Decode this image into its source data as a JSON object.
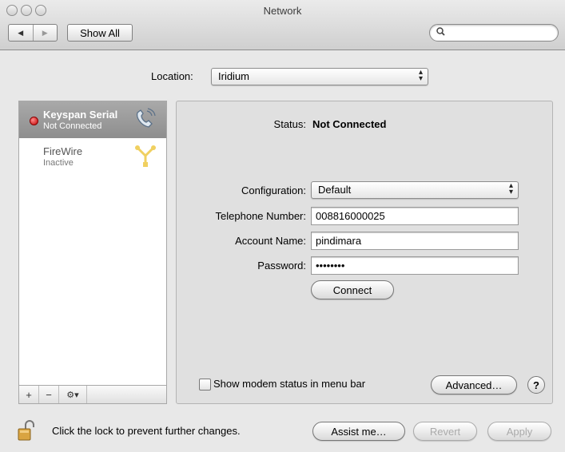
{
  "window": {
    "title": "Network"
  },
  "toolbar": {
    "show_all": "Show All",
    "search_placeholder": ""
  },
  "location": {
    "label": "Location:",
    "value": "Iridium"
  },
  "services": [
    {
      "name": "Keyspan Serial",
      "status": "Not Connected",
      "icon": "phone-modem-icon",
      "selected": true,
      "status_color": "#cc0000"
    },
    {
      "name": "FireWire",
      "status": "Inactive",
      "icon": "firewire-icon",
      "selected": false
    }
  ],
  "sidebar_controls": {
    "add": "+",
    "remove": "−",
    "action": "⚙▾"
  },
  "detail": {
    "status_label": "Status:",
    "status_value": "Not Connected",
    "configuration_label": "Configuration:",
    "configuration_value": "Default",
    "telephone_label": "Telephone Number:",
    "telephone_value": "008816000025",
    "account_label": "Account Name:",
    "account_value": "pindimara",
    "password_label": "Password:",
    "password_value": "••••••••",
    "connect_button": "Connect",
    "show_modem_status": "Show modem status in menu bar",
    "show_modem_status_checked": false,
    "advanced_button": "Advanced…",
    "help_button": "?"
  },
  "footer": {
    "lock_message": "Click the lock to prevent further changes.",
    "assist_button": "Assist me…",
    "revert_button": "Revert",
    "apply_button": "Apply"
  }
}
